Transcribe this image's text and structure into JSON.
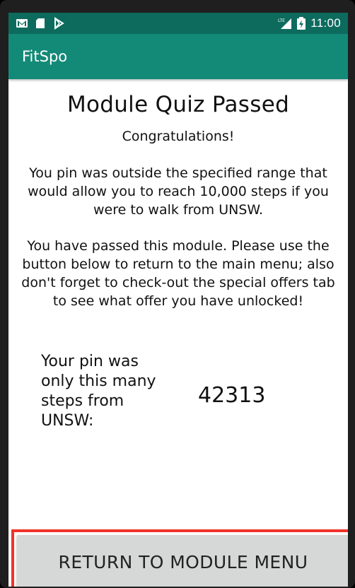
{
  "status_bar": {
    "time": "11:00",
    "network_label": "LTE",
    "left_icons": [
      "gmail-icon",
      "sd-card-icon",
      "play-store-icon"
    ],
    "right_icons": [
      "signal-icon",
      "battery-icon"
    ]
  },
  "app_bar": {
    "title": "FitSpo"
  },
  "main": {
    "title": "Module Quiz Passed",
    "congrats": "Congratulations!",
    "paragraph_1": "You pin was outside the specified range that would allow you to reach 10,000 steps if you were to walk from UNSW.",
    "paragraph_2": "You have passed this module. Please use the button below to return to the main menu; also don't forget to check-out the special offers tab to see what offer you have unlocked!",
    "steps_label": "Your pin was only this many steps from UNSW:",
    "steps_value": "42313"
  },
  "button": {
    "label": "RETURN TO MODULE MENU"
  },
  "colors": {
    "status_bar": "#0d6b5e",
    "app_bar": "#138a78",
    "highlight": "#f0332a",
    "button_bg": "#d6d7d7"
  }
}
